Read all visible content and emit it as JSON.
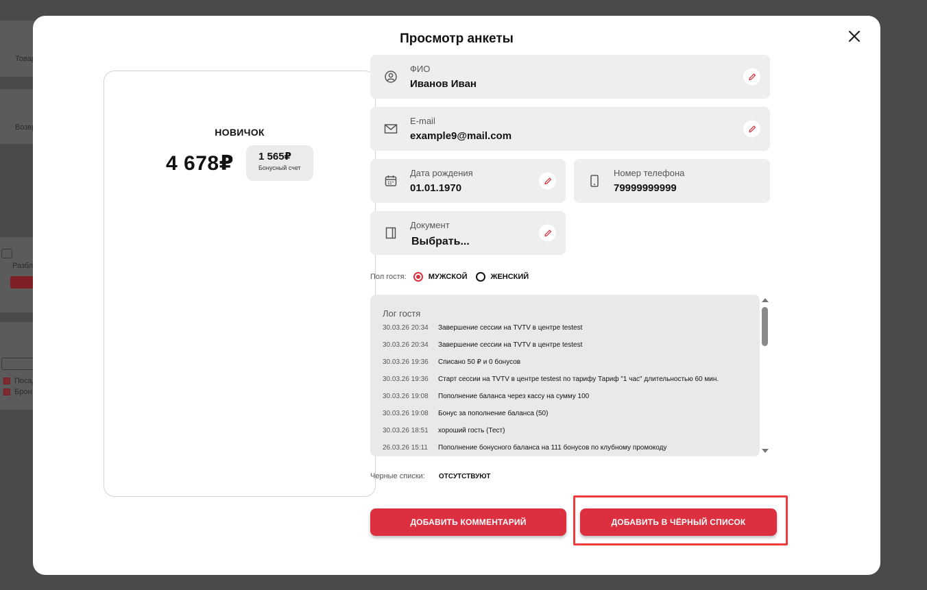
{
  "background": {
    "texts": [
      "Товар",
      "Возвр",
      "Разбл",
      "Посад",
      "Брон"
    ]
  },
  "modal": {
    "title": "Просмотр анкеты"
  },
  "card": {
    "level": "НОВИЧОК",
    "balance": "4 678₽",
    "bonus_value": "1 565₽",
    "bonus_label": "Бонусный счет"
  },
  "fields": {
    "fio": {
      "label": "ФИО",
      "value": "Иванов Иван"
    },
    "email": {
      "label": "E-mail",
      "value": "example9@mail.com"
    },
    "dob": {
      "label": "Дата рождения",
      "value": "01.01.1970"
    },
    "phone": {
      "label": "Номер телефона",
      "value": "79999999999"
    },
    "document": {
      "label": "Документ",
      "value": "Выбрать..."
    }
  },
  "gender": {
    "label": "Пол гостя:",
    "options": [
      {
        "label": "МУЖСКОЙ",
        "selected": true
      },
      {
        "label": "ЖЕНСКИЙ",
        "selected": false
      }
    ]
  },
  "log": {
    "title": "Лог гостя",
    "entries": [
      {
        "date": "30.03.26 20:34",
        "text": "Завершение сессии на TVTV в центре testest"
      },
      {
        "date": "30.03.26 20:34",
        "text": "Завершение сессии на TVTV в центре testest"
      },
      {
        "date": "30.03.26 19:36",
        "text": "Списано 50 ₽ и 0 бонусов"
      },
      {
        "date": "30.03.26 19:36",
        "text": "Старт сессии на TVTV в центре testest по тарифу Тариф \"1 час\" длительностью 60 мин."
      },
      {
        "date": "30.03.26 19:08",
        "text": "Пополнение баланса через кассу на сумму 100"
      },
      {
        "date": "30.03.26 19:08",
        "text": "Бонус за пополнение баланса (50)"
      },
      {
        "date": "30.03.26 18:51",
        "text": "хороший гость (Тест)"
      },
      {
        "date": "26.03.26 15:11",
        "text": "Пополнение бонусного баланса на 111 бонусов по клубному промокоду"
      }
    ]
  },
  "blacklist": {
    "label": "Черные списки:",
    "value": "ОТСУТСТВУЮТ"
  },
  "buttons": {
    "add_comment": "ДОБАВИТЬ КОММЕНТАРИЙ",
    "add_blacklist": "ДОБАВИТЬ В ЧЁРНЫЙ СПИСОК"
  },
  "colors": {
    "accent": "#dc3040",
    "highlight": "#ee3b3b",
    "field_bg": "#eeeeee",
    "overlay": "#4a4a4a"
  }
}
